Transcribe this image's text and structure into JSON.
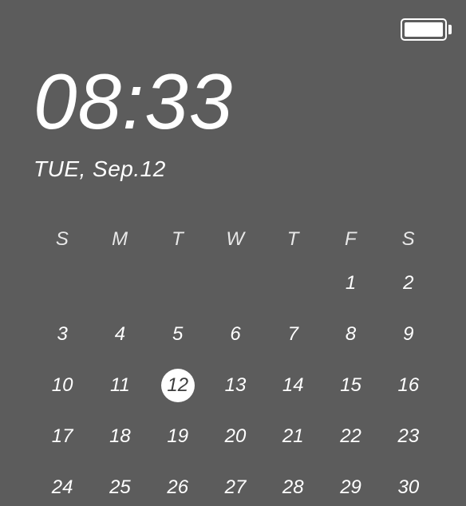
{
  "status": {
    "battery_percent": 100
  },
  "clock": {
    "time": "08:33",
    "date": "TUE, Sep.12"
  },
  "calendar": {
    "headers": [
      "S",
      "M",
      "T",
      "W",
      "T",
      "F",
      "S"
    ],
    "first_weekday_index": 5,
    "days": [
      "1",
      "2",
      "3",
      "4",
      "5",
      "6",
      "7",
      "8",
      "9",
      "10",
      "11",
      "12",
      "13",
      "14",
      "15",
      "16",
      "17",
      "18",
      "19",
      "20",
      "21",
      "22",
      "23",
      "24",
      "25",
      "26",
      "27",
      "28",
      "29",
      "30"
    ],
    "selected_day": "12"
  }
}
